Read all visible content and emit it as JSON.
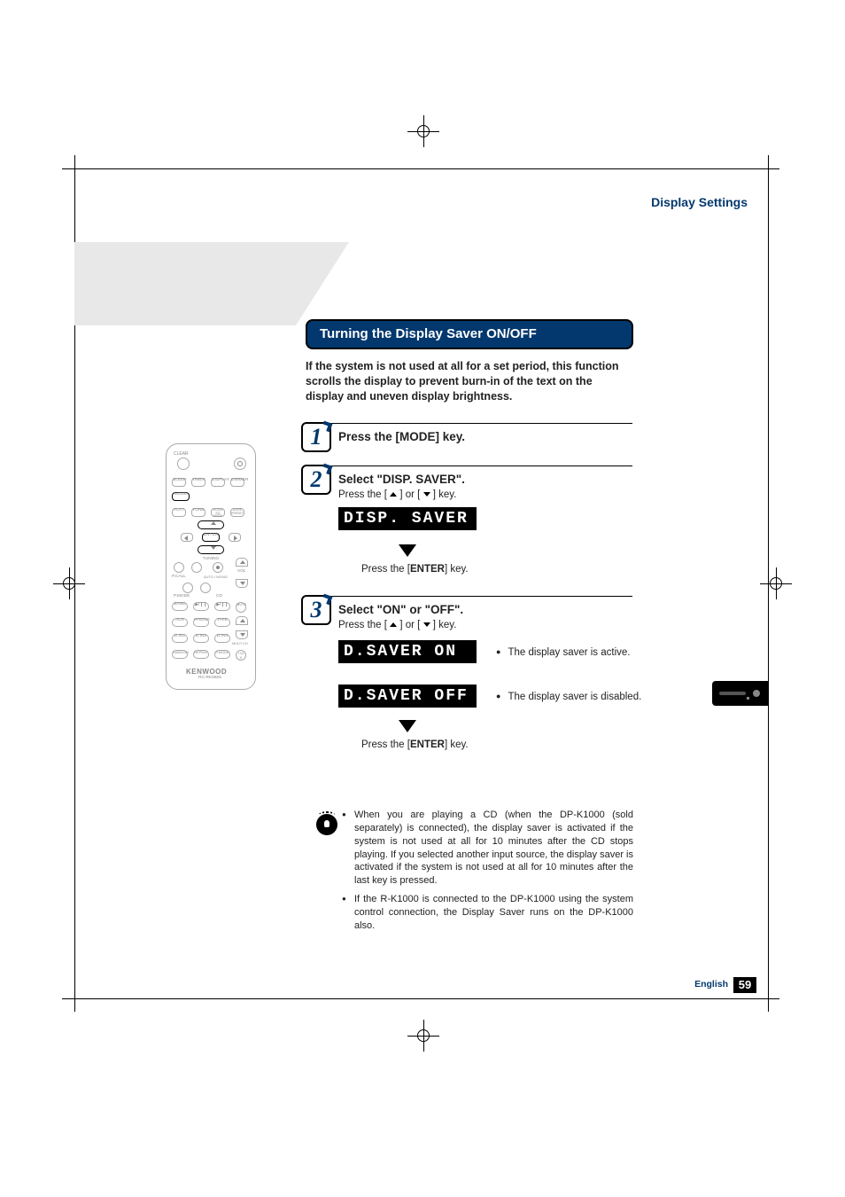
{
  "header": {
    "section": "Display Settings"
  },
  "section_title": "Turning the Display Saver ON/OFF",
  "intro": "If the system is not used at all for a set period, this function scrolls the display to prevent burn-in of the text on the display and uneven display brightness.",
  "steps": {
    "s1": {
      "num": "1",
      "title": "Press the [MODE] key."
    },
    "s2": {
      "num": "2",
      "title": "Select \"DISP. SAVER\".",
      "sub_pre": "Press the [ ",
      "sub_mid": " ] or [ ",
      "sub_post": " ] key.",
      "lcd": "DISP. SAVER",
      "enter_pre": "Press the [",
      "enter_key": "ENTER",
      "enter_post": "] key."
    },
    "s3": {
      "num": "3",
      "title": "Select \"ON\" or \"OFF\".",
      "sub_pre": "Press the [ ",
      "sub_mid": " ] or [ ",
      "sub_post": " ] key.",
      "lcd_on": "D.SAVER  ON",
      "lcd_off": "D.SAVER OFF",
      "note_on": "The display saver is active.",
      "note_off": "The display saver is disabled.",
      "enter_pre": "Press the [",
      "enter_key": "ENTER",
      "enter_post": "] key."
    }
  },
  "tips": {
    "t1": "When you are playing a CD (when the DP-K1000 (sold separately) is connected), the display saver is activated if the system is not used at all for 10 minutes after the CD stops playing. If you selected another input source, the display saver is activated if the system is not used at all for 10 minutes after the last key is pressed.",
    "t2": "If the R-K1000 is connected to the DP-K1000 using the system control connection, the Display Saver runs on the DP-K1000 also."
  },
  "footer": {
    "lang": "English",
    "page": "59"
  },
  "remote": {
    "clear": "CLEAR",
    "power": "power-icon",
    "row1": [
      "SLEEP",
      "TIMER",
      "DISPLAY",
      "DIMMER"
    ],
    "mode": "MODE",
    "row2": [
      "FLAT",
      "TONE",
      "ROOM EQ\nMODE",
      "AS/RE\nPRESET"
    ],
    "enter": "ENTER",
    "tuning": "TUNING",
    "pcall": "P.CALL",
    "automono": "AUTO / MONO",
    "vol": "VOL",
    "pmode": "P.MODE",
    "cd": "CD",
    "row3_left": "BAND",
    "row3_mid": "▶/❙❙",
    "row3_right": "▶/❙❙",
    "mute": "MUTE",
    "row4": [
      "AUX",
      "PHONO",
      "TAPE"
    ],
    "row5": [
      "D.IN1",
      "D.IN2",
      "D.IN3"
    ],
    "multich": "MULTI CH",
    "row6": [
      "RANDOM",
      "REPEAT",
      "P.MODE"
    ],
    "cd0": "+10\n0",
    "brand": "KENWOOD",
    "model": "RC-RK0605"
  }
}
